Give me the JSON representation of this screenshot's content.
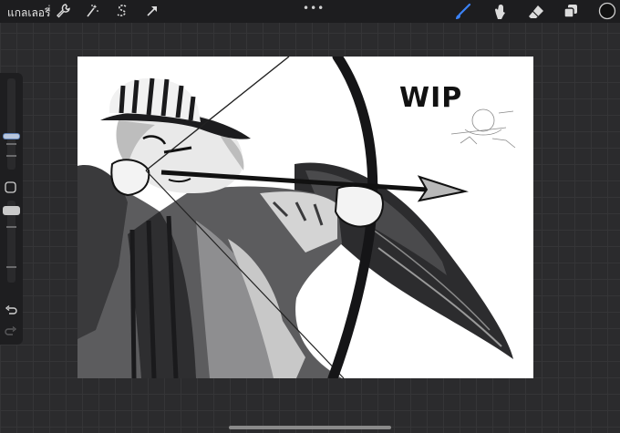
{
  "app": {
    "gallery_label": "แกลเลอรี่",
    "more_dots": "•••"
  },
  "toolbar": {
    "left_icons": [
      "wrench-icon",
      "magic-wand-icon",
      "selection-icon",
      "transform-arrow-icon"
    ],
    "right_icons": [
      "brush-icon",
      "smudge-icon",
      "eraser-icon",
      "layers-icon",
      "color-circle-icon"
    ],
    "accent": "#3b82f6"
  },
  "canvas": {
    "wip_text": "WIP"
  },
  "sidebar": {
    "icons": [
      "modify-square-icon",
      "undo-icon",
      "redo-icon"
    ]
  }
}
